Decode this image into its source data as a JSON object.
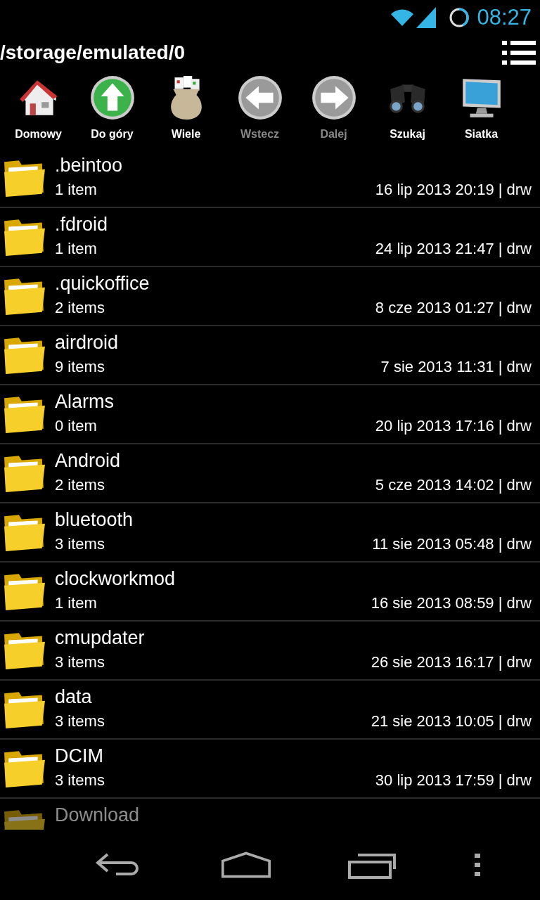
{
  "status_bar": {
    "time": "08:27"
  },
  "path": "/storage/emulated/0",
  "toolbar": [
    {
      "kind": "home",
      "label": "Domowy",
      "disabled": false
    },
    {
      "kind": "up",
      "label": "Do góry",
      "disabled": false
    },
    {
      "kind": "multi",
      "label": "Wiele",
      "disabled": false
    },
    {
      "kind": "back",
      "label": "Wstecz",
      "disabled": true
    },
    {
      "kind": "forward",
      "label": "Dalej",
      "disabled": true
    },
    {
      "kind": "search",
      "label": "Szukaj",
      "disabled": false
    },
    {
      "kind": "grid",
      "label": "Siatka",
      "disabled": false
    }
  ],
  "files": [
    {
      "name": ".beintoo",
      "count": "1 item",
      "meta": "16 lip 2013 20:19 | drw"
    },
    {
      "name": ".fdroid",
      "count": "1 item",
      "meta": "24 lip 2013 21:47 | drw"
    },
    {
      "name": ".quickoffice",
      "count": "2 items",
      "meta": "8 cze 2013 01:27 | drw"
    },
    {
      "name": "airdroid",
      "count": "9 items",
      "meta": "7 sie 2013 11:31 | drw"
    },
    {
      "name": "Alarms",
      "count": "0 item",
      "meta": "20 lip 2013 17:16 | drw"
    },
    {
      "name": "Android",
      "count": "2 items",
      "meta": "5 cze 2013 14:02 | drw"
    },
    {
      "name": "bluetooth",
      "count": "3 items",
      "meta": "11 sie 2013 05:48 | drw"
    },
    {
      "name": "clockworkmod",
      "count": "1 item",
      "meta": "16 sie 2013 08:59 | drw"
    },
    {
      "name": "cmupdater",
      "count": "3 items",
      "meta": "26 sie 2013 16:17 | drw"
    },
    {
      "name": "data",
      "count": "3 items",
      "meta": "21 sie 2013 10:05 | drw"
    },
    {
      "name": "DCIM",
      "count": "3 items",
      "meta": "30 lip 2013 17:59 | drw"
    },
    {
      "name": "Download"
    }
  ]
}
